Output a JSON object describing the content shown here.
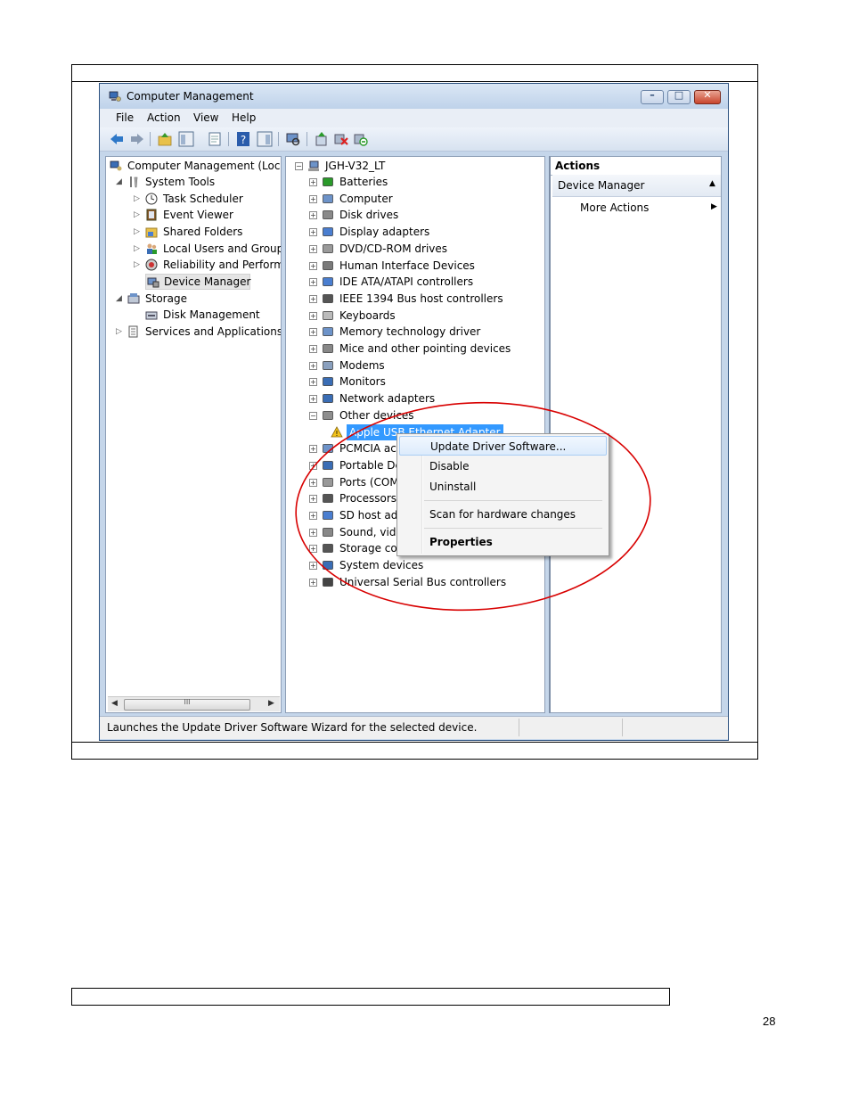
{
  "page": {
    "page_number": "28"
  },
  "window": {
    "title": "Computer Management",
    "controls": [
      "minimize",
      "maximize",
      "close"
    ]
  },
  "menubar": [
    "File",
    "Action",
    "View",
    "Help"
  ],
  "left_tree": [
    {
      "label": "Computer Management (Local",
      "level": 0,
      "icon": "computer-management-icon"
    },
    {
      "label": "System Tools",
      "level": 1,
      "icon": "system-tools-icon",
      "expanded": true
    },
    {
      "label": "Task Scheduler",
      "level": 2,
      "icon": "clock-icon"
    },
    {
      "label": "Event Viewer",
      "level": 2,
      "icon": "event-viewer-icon"
    },
    {
      "label": "Shared Folders",
      "level": 2,
      "icon": "shared-folder-icon"
    },
    {
      "label": "Local Users and Groups",
      "level": 2,
      "icon": "users-icon"
    },
    {
      "label": "Reliability and Performa",
      "level": 2,
      "icon": "performance-icon"
    },
    {
      "label": "Device Manager",
      "level": 2,
      "icon": "device-manager-icon",
      "selected": true
    },
    {
      "label": "Storage",
      "level": 1,
      "icon": "storage-icon",
      "expanded": true
    },
    {
      "label": "Disk Management",
      "level": 2,
      "icon": "disk-management-icon"
    },
    {
      "label": "Services and Applications",
      "level": 1,
      "icon": "services-icon"
    }
  ],
  "left_scroll_glyph": "III",
  "device_tree": {
    "root": "JGH-V32_LT",
    "items": [
      "Batteries",
      "Computer",
      "Disk drives",
      "Display adapters",
      "DVD/CD-ROM drives",
      "Human Interface Devices",
      "IDE ATA/ATAPI controllers",
      "IEEE 1394 Bus host controllers",
      "Keyboards",
      "Memory technology driver",
      "Mice and other pointing devices",
      "Modems",
      "Monitors",
      "Network adapters",
      "Other devices",
      "Apple USB Ethernet Adapter",
      "PCMCIA ac",
      "Portable De",
      "Ports (COM",
      "Processors",
      "SD host ada",
      "Sound, vide",
      "Storage cor",
      "System devices",
      "Universal Serial Bus controllers"
    ]
  },
  "context_menu": {
    "items": [
      "Update Driver Software...",
      "Disable",
      "Uninstall",
      "Scan for hardware changes",
      "Properties"
    ],
    "highlighted": "Update Driver Software..."
  },
  "actions_pane": {
    "title": "Actions",
    "section": "Device Manager",
    "items": [
      "More Actions"
    ]
  },
  "status_bar": {
    "text": "Launches the Update Driver Software Wizard for the selected device."
  },
  "colors": {
    "annotation_ellipse": "#d80000",
    "selection_highlight": "#3399ff"
  }
}
